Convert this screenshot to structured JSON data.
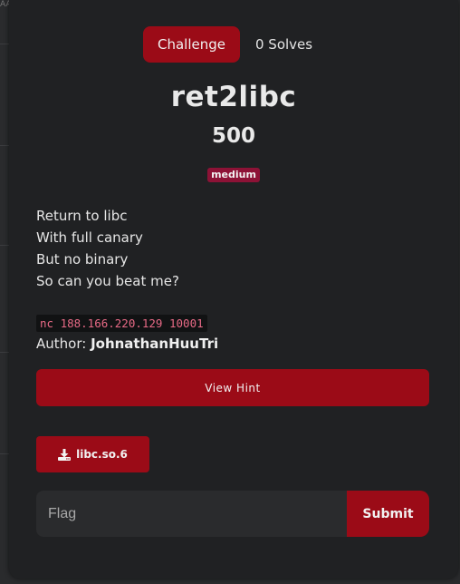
{
  "tabs": {
    "challenge_label": "Challenge",
    "solves_label": "0 Solves"
  },
  "challenge": {
    "name": "ret2libc",
    "points": "500",
    "difficulty": "medium",
    "description": [
      "Return to libc",
      "With full canary",
      "But no binary",
      "So can you beat me?"
    ],
    "connection": "nc 188.166.220.129 10001",
    "author_label": "Author: ",
    "author_name": "JohnathanHuuTri"
  },
  "actions": {
    "hint_label": "View Hint",
    "file_label": "libc.so.6",
    "file_icon": "download-icon",
    "submit_label": "Submit"
  },
  "flag_input": {
    "placeholder": "Flag",
    "value": ""
  },
  "colors": {
    "accent": "#9b0b17",
    "badge": "#8d1236",
    "code_text": "#e86a86",
    "modal_bg": "#202123"
  },
  "edge_fragment": "AA"
}
